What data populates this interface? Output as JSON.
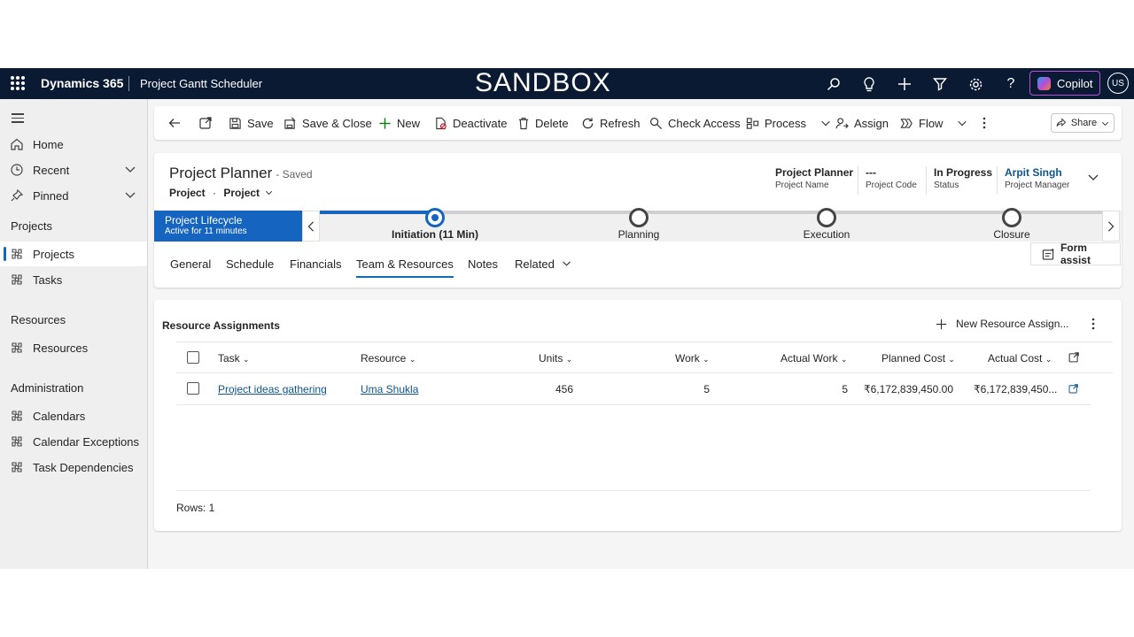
{
  "topbar": {
    "brand": "Dynamics 365",
    "app_name": "Project Gantt Scheduler",
    "environment": "SANDBOX",
    "copilot_label": "Copilot",
    "user_initials": "US",
    "icons": [
      "search-icon",
      "lightbulb-icon",
      "plus-icon",
      "filter-icon",
      "gear-icon",
      "help-icon"
    ]
  },
  "sidebar": {
    "items_top": [
      {
        "label": "Home",
        "icon": "home-icon"
      },
      {
        "label": "Recent",
        "icon": "clock-icon"
      },
      {
        "label": "Pinned",
        "icon": "pin-icon"
      }
    ],
    "sections": [
      {
        "title": "Projects",
        "items": [
          {
            "label": "Projects",
            "active": true
          },
          {
            "label": "Tasks"
          }
        ]
      },
      {
        "title": "Resources",
        "items": [
          {
            "label": "Resources"
          }
        ]
      },
      {
        "title": "Administration",
        "items": [
          {
            "label": "Calendars"
          },
          {
            "label": "Calendar Exceptions"
          },
          {
            "label": "Task Dependencies"
          }
        ]
      }
    ]
  },
  "commandbar": {
    "save": "Save",
    "save_close": "Save & Close",
    "new": "New",
    "deactivate": "Deactivate",
    "delete": "Delete",
    "refresh": "Refresh",
    "check_access": "Check Access",
    "process": "Process",
    "assign": "Assign",
    "flow": "Flow",
    "share": "Share"
  },
  "record": {
    "title": "Project Planner",
    "saved": "- Saved",
    "entity": "Project",
    "separator": "·",
    "form": "Project",
    "header_fields": [
      {
        "value": "Project Planner",
        "label": "Project Name"
      },
      {
        "value": "---",
        "label": "Project Code"
      },
      {
        "value": "In Progress",
        "label": "Status"
      },
      {
        "value": "Arpit Singh",
        "label": "Project Manager"
      }
    ]
  },
  "bpf": {
    "name": "Project Lifecycle",
    "active_for": "Active for 11 minutes",
    "stages": [
      "Initiation  (11 Min)",
      "Planning",
      "Execution",
      "Closure"
    ],
    "active_stage_index": 0
  },
  "tabs": [
    "General",
    "Schedule",
    "Financials",
    "Team & Resources",
    "Notes",
    "Related"
  ],
  "selected_tab": "Team & Resources",
  "form_assist": "Form assist",
  "grid": {
    "title": "Resource Assignments",
    "new_button": "New Resource Assign...",
    "columns": [
      "Task",
      "Resource",
      "Units",
      "Work",
      "Actual Work",
      "Planned Cost",
      "Actual Cost"
    ],
    "rows": [
      {
        "task": "Project ideas gathering",
        "resource": "Uma Shukla",
        "units": "456",
        "work": "5",
        "actual_work": "5",
        "planned_cost": "₹6,172,839,450.00",
        "actual_cost": "₹6,172,839,450..."
      }
    ],
    "rows_count": "Rows: 1"
  },
  "colors": {
    "topbar_bg": "#0b1a33",
    "accent": "#0f6cbd",
    "bpf_active": "#1565c0",
    "link": "#0f548c"
  }
}
